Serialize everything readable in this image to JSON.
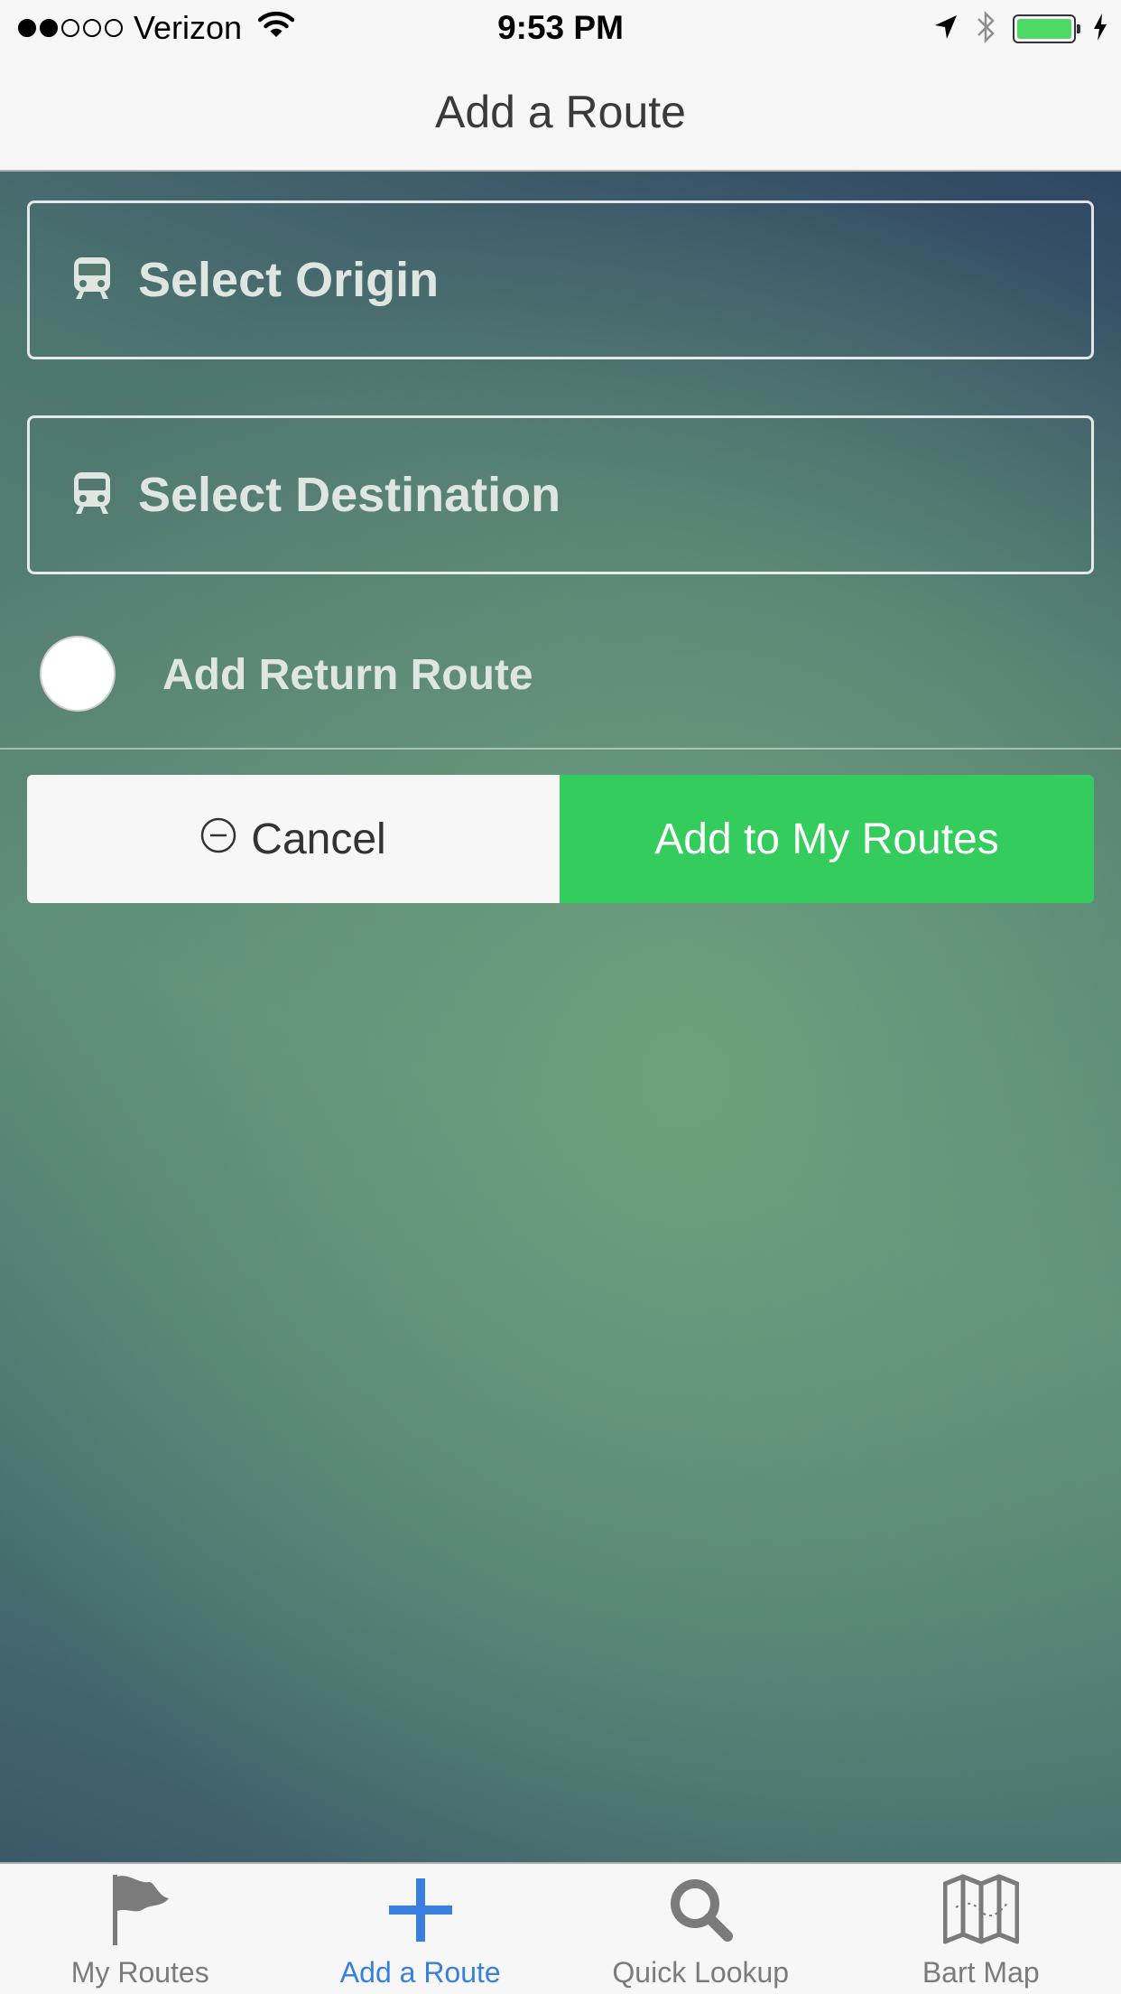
{
  "status_bar": {
    "carrier": "Verizon",
    "time": "9:53 PM",
    "signal_filled": 2,
    "signal_total": 5,
    "battery_percent": 100
  },
  "nav": {
    "title": "Add a Route"
  },
  "form": {
    "origin_label": "Select Origin",
    "destination_label": "Select Destination",
    "return_route_label": "Add Return Route",
    "return_route_enabled": false
  },
  "actions": {
    "cancel_label": "Cancel",
    "add_label": "Add to My Routes"
  },
  "tabs": [
    {
      "label": "My Routes",
      "icon": "flag-icon"
    },
    {
      "label": "Add a Route",
      "icon": "plus-icon"
    },
    {
      "label": "Quick Lookup",
      "icon": "search-icon"
    },
    {
      "label": "Bart Map",
      "icon": "map-icon"
    }
  ],
  "colors": {
    "accent_green": "#34cc5c",
    "tab_active": "#3a7fe0",
    "tab_inactive": "#7b7b7b",
    "battery_green": "#4cd964"
  }
}
